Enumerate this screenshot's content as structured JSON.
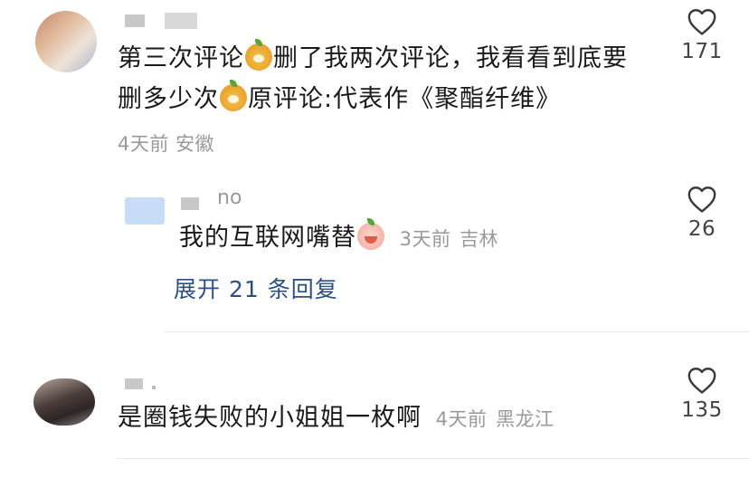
{
  "comments": [
    {
      "username": "",
      "text_line1_a": "第三次评论",
      "text_line1_b": "删了我两次评论，我看看到底要",
      "text_line2_a": "删多少次",
      "text_line2_b": "原评论:代表作《聚酯纤维》",
      "emoji": "dog-emoji",
      "time": "4天前",
      "location": "安徽",
      "likes": "171"
    },
    {
      "username_suffix": "no",
      "text": "我的互联网嘴替",
      "emoji": "face-emoji",
      "time": "3天前",
      "location": "吉林",
      "likes": "26",
      "expand_label": "展开 21 条回复"
    },
    {
      "username": "",
      "text": "是圈钱失败的小姐姐一枚啊",
      "time": "4天前",
      "location": "黑龙江",
      "likes": "135"
    }
  ],
  "icons": {
    "like": "heart-outline-icon"
  },
  "colors": {
    "text": "#1a1a1a",
    "meta": "#9a9a9a",
    "expand_link": "#2b4f86",
    "username_placeholder": "#c8c8c8"
  }
}
